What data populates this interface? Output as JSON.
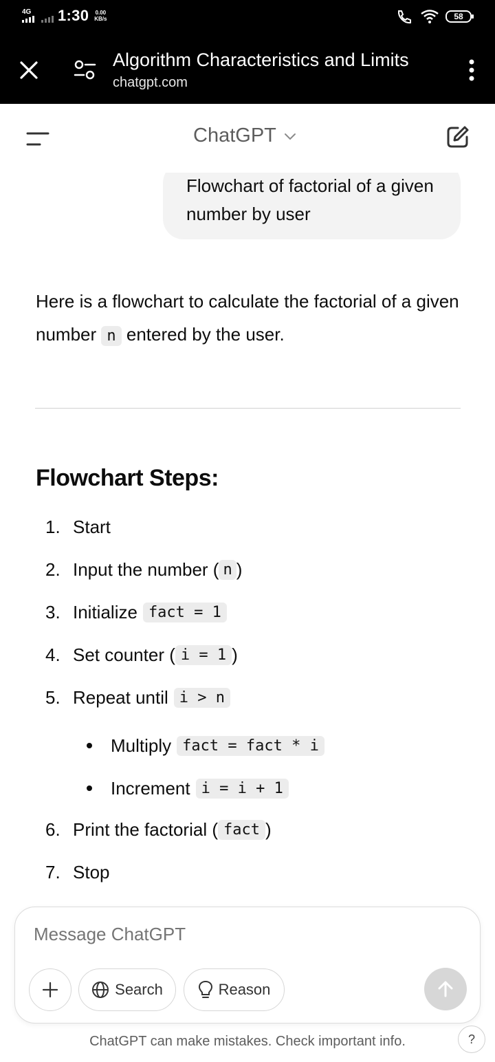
{
  "status_bar": {
    "network": "4G",
    "time": "1:30",
    "speed_value": "0.00",
    "speed_unit": "KB/s",
    "battery": "58"
  },
  "browser": {
    "title": "Algorithm Characteristics and Limits",
    "url": "chatgpt.com",
    "close_icon": "close-icon",
    "tune_icon": "tune-icon",
    "menu_icon": "more-vert-icon"
  },
  "header": {
    "model": "ChatGPT"
  },
  "user_message": "Flowchart of factorial of a given number by user",
  "assistant": {
    "intro_before": "Here is a flowchart to calculate the factorial of a given number ",
    "intro_code": "n",
    "intro_after": " entered by the user.",
    "heading": "Flowchart Steps:",
    "steps": [
      {
        "num": "1.",
        "text": "Start",
        "code": "",
        "after": ""
      },
      {
        "num": "2.",
        "text": "Input the number (",
        "code": "n",
        "after": ")"
      },
      {
        "num": "3.",
        "text": "Initialize ",
        "code": "fact = 1",
        "after": ""
      },
      {
        "num": "4.",
        "text": "Set counter (",
        "code": "i = 1",
        "after": ")"
      },
      {
        "num": "5.",
        "text": "Repeat until ",
        "code": "i > n",
        "after": ""
      },
      {
        "num": "6.",
        "text": "Print the factorial (",
        "code": "fact",
        "after": ")"
      },
      {
        "num": "7.",
        "text": "Stop",
        "code": "",
        "after": ""
      }
    ],
    "substeps": [
      {
        "text": "Multiply ",
        "code": "fact = fact * i"
      },
      {
        "text": "Increment ",
        "code": "i = i + 1"
      }
    ]
  },
  "composer": {
    "placeholder": "Message ChatGPT",
    "search_label": "Search",
    "reason_label": "Reason"
  },
  "footer": {
    "disclaimer": "ChatGPT can make mistakes. Check important info.",
    "help": "?"
  }
}
